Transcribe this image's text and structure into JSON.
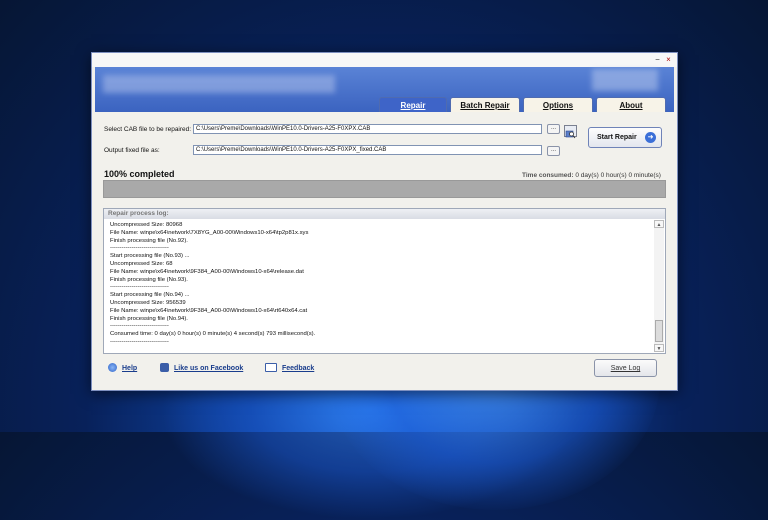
{
  "window": {
    "controls": {
      "minimize_icon": "−",
      "close_icon": "×"
    }
  },
  "tabs": [
    {
      "label": "Repair",
      "active": true
    },
    {
      "label": "Batch Repair",
      "active": false
    },
    {
      "label": "Options",
      "active": false
    },
    {
      "label": "About",
      "active": false
    }
  ],
  "form": {
    "cab_label": "Select CAB file to be repaired:",
    "cab_value": "C:\\Users\\Preme\\Downloads\\WinPE10.0-Drivers-A25-F0XPX.CAB",
    "output_label": "Output fixed file as:",
    "output_value": "C:\\Users\\Preme\\Downloads\\WinPE10.0-Drivers-A25-F0XPX_fixed.CAB",
    "browse_label": "...",
    "start_repair_label": "Start Repair"
  },
  "progress": {
    "status": "100% completed",
    "time_label": "Time consumed:",
    "time_value": "0 day(s) 0 hour(s) 0 minute(s)",
    "percent": 100
  },
  "log": {
    "header": "Repair process log:",
    "lines": [
      "Uncompressed Size: 80968",
      "File Name: winpe\\x64\\network\\7X8YG_A00-00\\Windows10-x64\\tp2p81x.sys",
      "Finish processing file (No.92).",
      "------------------------------",
      "Start processing file (No.93) ...",
      "Uncompressed Size: 68",
      "File Name: winpe\\x64\\network\\9F384_A00-00\\Windows10-x64\\release.dat",
      "Finish processing file (No.93).",
      "------------------------------",
      "Start processing file (No.94) ...",
      "Uncompressed Size: 956539",
      "File Name: winpe\\x64\\network\\9F384_A00-00\\Windows10-x64\\rt640x64.cat",
      "Finish processing file (No.94).",
      "------------------------------",
      "Consumed time: 0 day(s) 0 hour(s) 0 minute(s) 4 second(s) 793 millisecond(s).",
      "------------------------------"
    ]
  },
  "footer": {
    "help_label": "Help",
    "facebook_label": "Like us on Facebook",
    "feedback_label": "Feedback",
    "save_log_label": "Save Log"
  },
  "colors": {
    "accent": "#3e64c8",
    "banner": "#4a72cc",
    "link": "#1a3d8c",
    "progress": "#a9a9a9"
  },
  "icons": {
    "help": "help-icon",
    "facebook": "facebook-like-icon",
    "feedback": "envelope-icon",
    "start": "arrow-right-icon",
    "browse": "folder-search-icon"
  }
}
